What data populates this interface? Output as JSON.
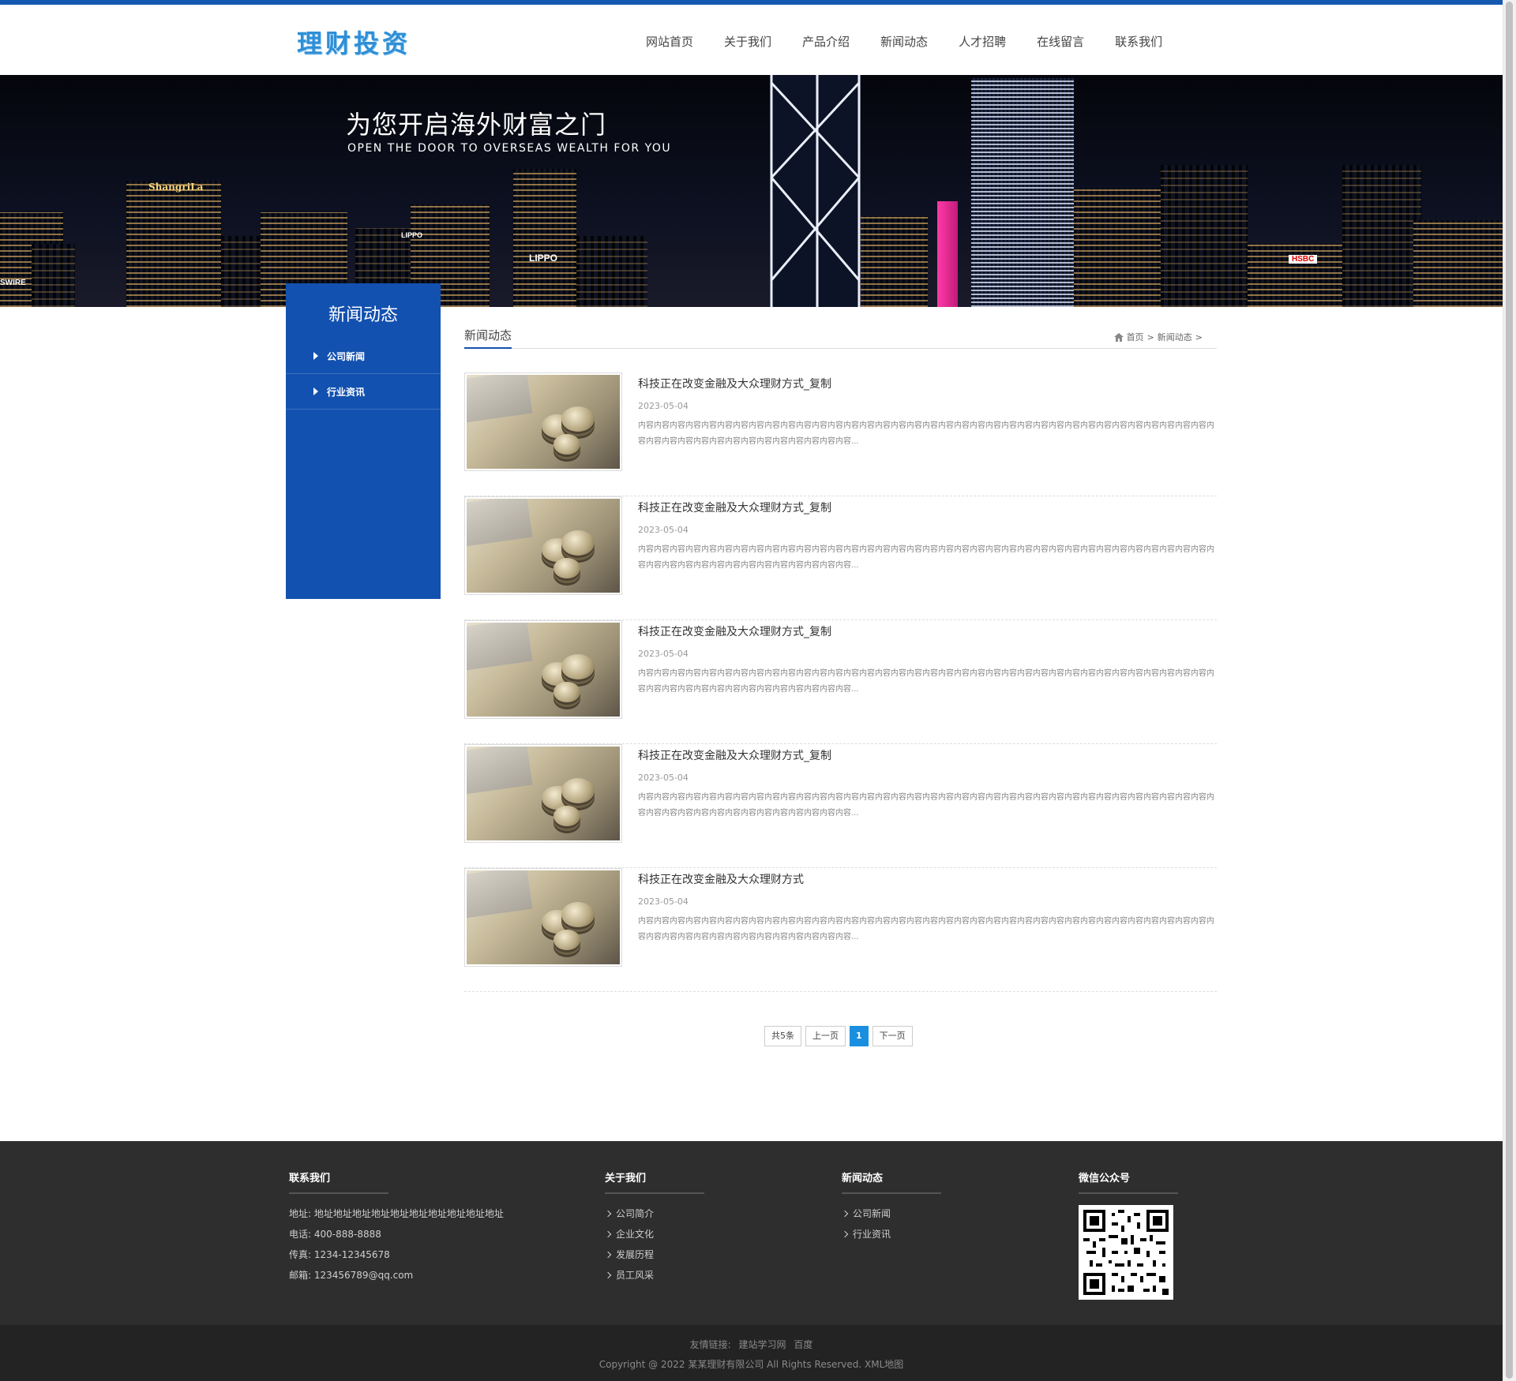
{
  "header": {
    "logo": "理财投资",
    "nav": [
      "网站首页",
      "关于我们",
      "产品介绍",
      "新闻动态",
      "人才招聘",
      "在线留言",
      "联系我们"
    ]
  },
  "banner": {
    "title": "为您开启海外财富之门",
    "subtitle": "OPEN THE DOOR TO OVERSEAS WEALTH FOR YOU",
    "signs": [
      "ShangriLa",
      "LIPPO",
      "LIPPO",
      "HSBC",
      "SWIRE"
    ]
  },
  "sidebar": {
    "title": "新闻动态",
    "items": [
      "公司新闻",
      "行业资讯"
    ]
  },
  "content": {
    "title": "新闻动态",
    "breadcrumb": {
      "home": "首页",
      "sep1": ">",
      "current": "新闻动态",
      "sep2": ">"
    },
    "icon": "home-icon"
  },
  "news": [
    {
      "title": "科技正在改变金融及大众理财方式_复制",
      "date": "2023-05-04",
      "summary": "内容内容内容内容内容内容内容内容内容内容内容内容内容内容内容内容内容内容内容内容内容内容内容内容内容内容内容内容内容内容内容内容内容内容内容内容内容内容内容内容内容内容内容内容内容内容内容内容内容内容..."
    },
    {
      "title": "科技正在改变金融及大众理财方式_复制",
      "date": "2023-05-04",
      "summary": "内容内容内容内容内容内容内容内容内容内容内容内容内容内容内容内容内容内容内容内容内容内容内容内容内容内容内容内容内容内容内容内容内容内容内容内容内容内容内容内容内容内容内容内容内容内容内容内容内容内容..."
    },
    {
      "title": "科技正在改变金融及大众理财方式_复制",
      "date": "2023-05-04",
      "summary": "内容内容内容内容内容内容内容内容内容内容内容内容内容内容内容内容内容内容内容内容内容内容内容内容内容内容内容内容内容内容内容内容内容内容内容内容内容内容内容内容内容内容内容内容内容内容内容内容内容内容..."
    },
    {
      "title": "科技正在改变金融及大众理财方式_复制",
      "date": "2023-05-04",
      "summary": "内容内容内容内容内容内容内容内容内容内容内容内容内容内容内容内容内容内容内容内容内容内容内容内容内容内容内容内容内容内容内容内容内容内容内容内容内容内容内容内容内容内容内容内容内容内容内容内容内容内容..."
    },
    {
      "title": "科技正在改变金融及大众理财方式",
      "date": "2023-05-04",
      "summary": "内容内容内容内容内容内容内容内容内容内容内容内容内容内容内容内容内容内容内容内容内容内容内容内容内容内容内容内容内容内容内容内容内容内容内容内容内容内容内容内容内容内容内容内容内容内容内容内容内容内容..."
    }
  ],
  "pagination": {
    "total": "共5条",
    "prev": "上一页",
    "current": "1",
    "next": "下一页"
  },
  "footer": {
    "contact": {
      "heading": "联系我们",
      "lines": [
        "地址: 地址地址地址地址地址地址地址地址地址地址",
        "电话: 400-888-8888",
        "传真: 1234-12345678",
        "邮箱: 123456789@qq.com"
      ]
    },
    "about": {
      "heading": "关于我们",
      "links": [
        "公司简介",
        "企业文化",
        "发展历程",
        "员工风采"
      ]
    },
    "news": {
      "heading": "新闻动态",
      "links": [
        "公司新闻",
        "行业资讯"
      ]
    },
    "wechat": {
      "heading": "微信公众号"
    }
  },
  "bottom": {
    "friend_label": "友情链接:",
    "friend_links": [
      "建站学习网",
      "百度"
    ],
    "copyright": "Copyright @ 2022 某某理财有限公司 All Rights Reserved. XML地图"
  },
  "colors": {
    "brand_blue": "#1351b0",
    "accent_blue": "#1a8fe0",
    "logo_blue": "#2f8fd6",
    "footer_bg": "#2e2e2e"
  }
}
